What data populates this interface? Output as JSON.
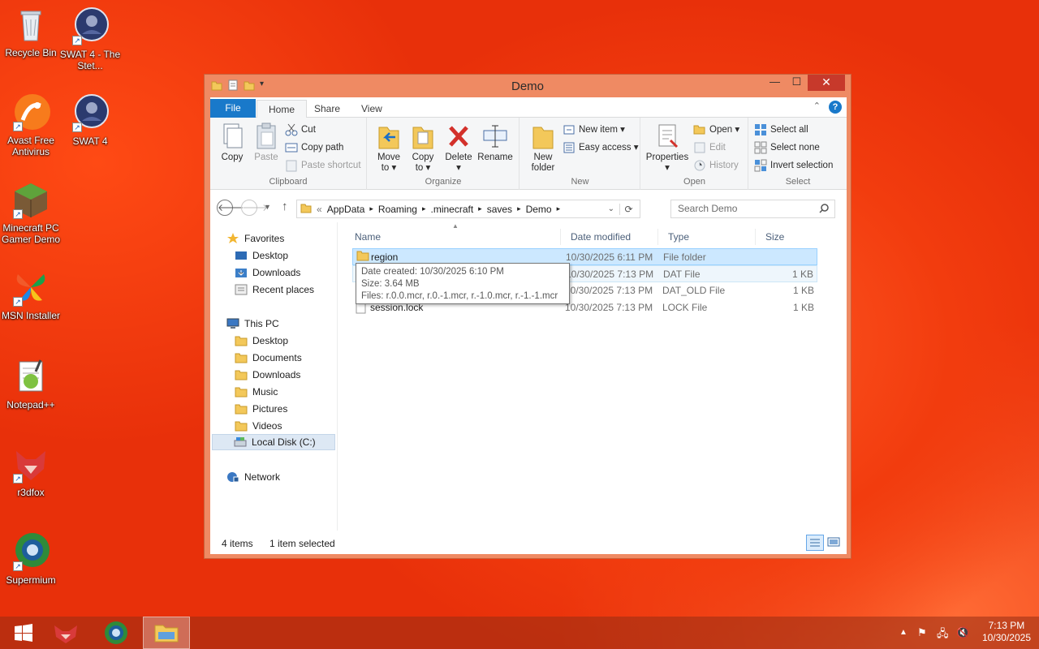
{
  "desktop": {
    "icons": [
      {
        "label": "Recycle Bin"
      },
      {
        "label": "SWAT 4 - The Stet..."
      },
      {
        "label": "Avast Free Antivirus"
      },
      {
        "label": "SWAT 4"
      },
      {
        "label": "Minecraft PC Gamer Demo"
      },
      {
        "label": "MSN Installer"
      },
      {
        "label": "Notepad++"
      },
      {
        "label": "r3dfox"
      },
      {
        "label": "Supermium"
      }
    ]
  },
  "window": {
    "title": "Demo",
    "minimize": "—",
    "maximize": "☐",
    "close": "✕"
  },
  "ribbon": {
    "tabs": {
      "file": "File",
      "home": "Home",
      "share": "Share",
      "view": "View"
    },
    "clipboard": {
      "label": "Clipboard",
      "copy": "Copy",
      "paste": "Paste",
      "cut": "Cut",
      "copy_path": "Copy path",
      "paste_shortcut": "Paste shortcut"
    },
    "organize": {
      "label": "Organize",
      "move_to": "Move",
      "move_to2": "to ▾",
      "copy_to": "Copy",
      "copy_to2": "to ▾",
      "delete": "Delete",
      "delete2": "▾",
      "rename": "Rename"
    },
    "new": {
      "label": "New",
      "new_folder": "New",
      "new_folder2": "folder",
      "new_item": "New item ▾",
      "easy_access": "Easy access ▾"
    },
    "open": {
      "label": "Open",
      "properties": "Properties",
      "properties2": "▾",
      "open": "Open ▾",
      "edit": "Edit",
      "history": "History"
    },
    "select": {
      "label": "Select",
      "select_all": "Select all",
      "select_none": "Select none",
      "invert": "Invert selection"
    }
  },
  "address": {
    "crumbs": [
      "«",
      "AppData",
      "▸",
      "Roaming",
      "▸",
      ".minecraft",
      "▸",
      "saves",
      "▸",
      "Demo",
      "▸"
    ],
    "search_placeholder": "Search Demo"
  },
  "navpane": {
    "favorites": "Favorites",
    "fav_items": [
      "Desktop",
      "Downloads",
      "Recent places"
    ],
    "thispc": "This PC",
    "pc_items": [
      "Desktop",
      "Documents",
      "Downloads",
      "Music",
      "Pictures",
      "Videos",
      "Local Disk (C:)"
    ],
    "network": "Network"
  },
  "columns": {
    "name": "Name",
    "date": "Date modified",
    "type": "Type",
    "size": "Size"
  },
  "files": [
    {
      "name": "region",
      "date": "10/30/2025 6:11 PM",
      "type": "File folder",
      "size": ""
    },
    {
      "name": "",
      "date": "10/30/2025 7:13 PM",
      "type": "DAT File",
      "size": "1 KB"
    },
    {
      "name": "",
      "date": "10/30/2025 7:13 PM",
      "type": "DAT_OLD File",
      "size": "1 KB"
    },
    {
      "name": "session.lock",
      "date": "10/30/2025 7:13 PM",
      "type": "LOCK File",
      "size": "1 KB"
    }
  ],
  "tooltip": {
    "line1": "Date created: 10/30/2025 6:10 PM",
    "line2": "Size: 3.64 MB",
    "line3": "Files: r.0.0.mcr, r.0.-1.mcr, r.-1.0.mcr, r.-1.-1.mcr"
  },
  "status": {
    "count": "4 items",
    "selected": "1 item selected"
  },
  "taskbar": {
    "time": "7:13 PM",
    "date": "10/30/2025"
  },
  "colors": {
    "accent": "#1979ca",
    "close": "#c7392b",
    "selection": "#cce8ff",
    "desktop": "#e8300a"
  }
}
